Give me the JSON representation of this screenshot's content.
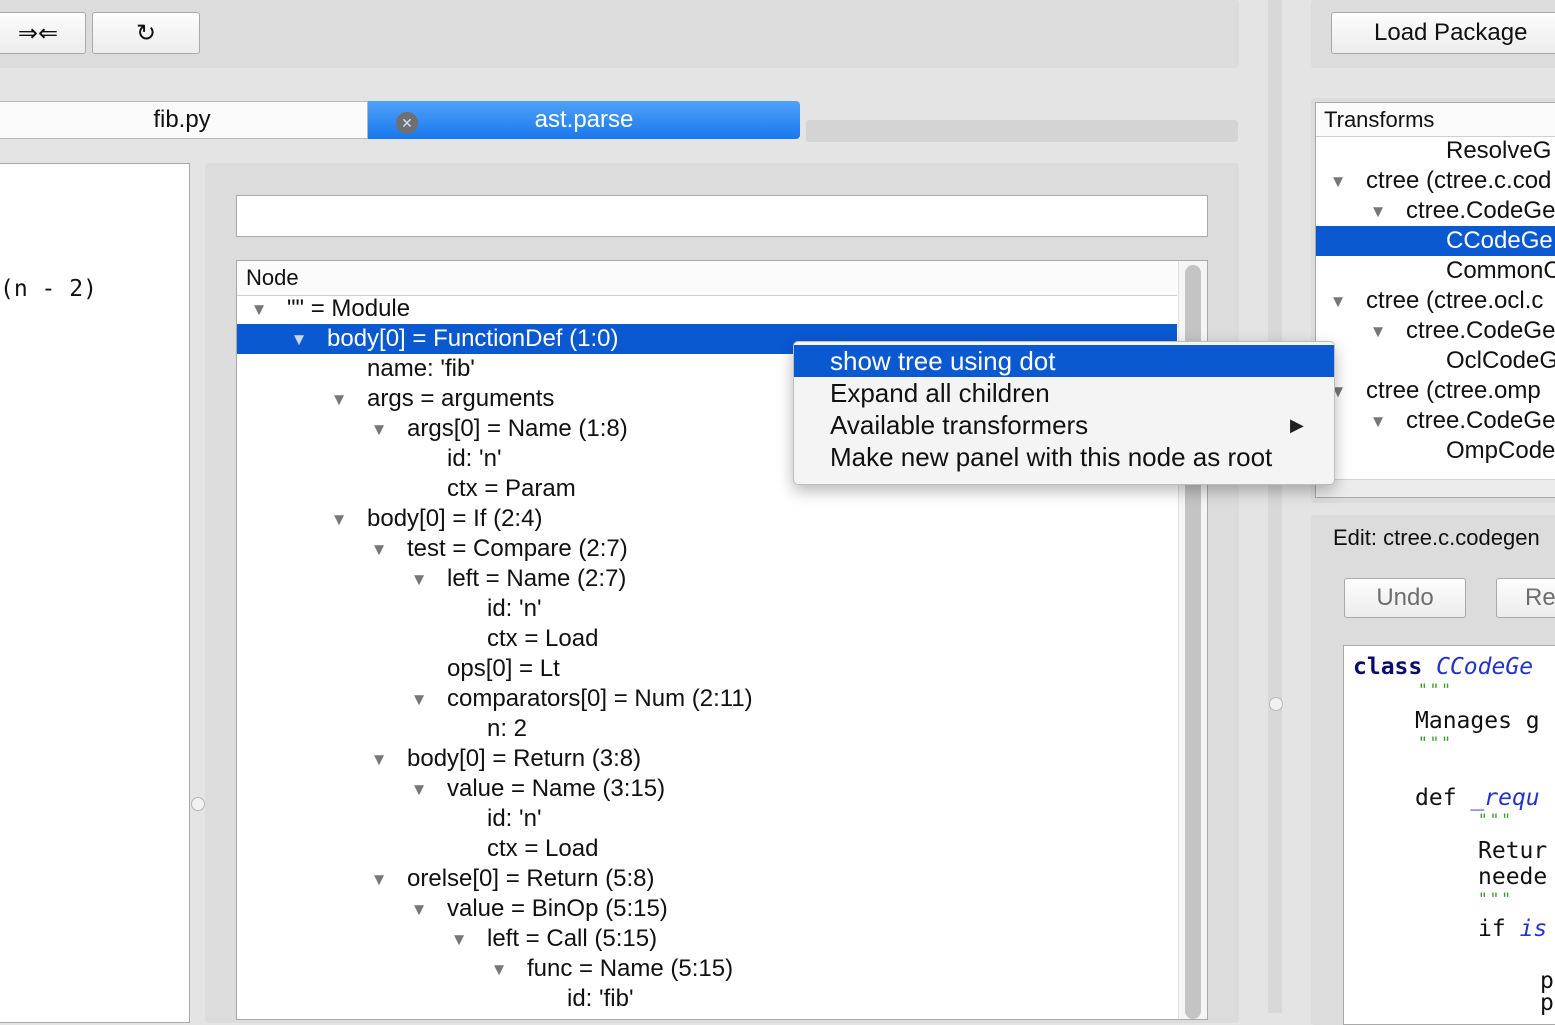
{
  "toolbar": {
    "nav_glyph": "⇒⇐",
    "refresh_glyph": "↻",
    "load_package_label": "Load Package"
  },
  "tabs": [
    {
      "label": "fib.py",
      "active": false
    },
    {
      "label": "ast.parse",
      "active": true,
      "closable": true
    }
  ],
  "close_glyph": "✕",
  "source_fragment": "(n - 2)",
  "ast_search": {
    "value": "",
    "placeholder": ""
  },
  "ast_tree": {
    "header": "Node",
    "rows": [
      {
        "label": "\"\" = Module",
        "expanded": true,
        "depth": 0
      },
      {
        "label": "body[0] = FunctionDef (1:0)",
        "expanded": true,
        "depth": 1,
        "selected": true
      },
      {
        "label": "name: 'fib'",
        "depth": 2
      },
      {
        "label": "args = arguments",
        "expanded": true,
        "depth": 2
      },
      {
        "label": "args[0] = Name (1:8)",
        "expanded": true,
        "depth": 3
      },
      {
        "label": "id: 'n'",
        "depth": 4
      },
      {
        "label": "ctx = Param",
        "depth": 4
      },
      {
        "label": "body[0] = If (2:4)",
        "expanded": true,
        "depth": 2
      },
      {
        "label": "test = Compare (2:7)",
        "expanded": true,
        "depth": 3
      },
      {
        "label": "left = Name (2:7)",
        "expanded": true,
        "depth": 4
      },
      {
        "label": "id: 'n'",
        "depth": 5
      },
      {
        "label": "ctx = Load",
        "depth": 5
      },
      {
        "label": "ops[0] = Lt",
        "depth": 4
      },
      {
        "label": "comparators[0] = Num (2:11)",
        "expanded": true,
        "depth": 4
      },
      {
        "label": "n: 2",
        "depth": 5
      },
      {
        "label": "body[0] = Return (3:8)",
        "expanded": true,
        "depth": 3
      },
      {
        "label": "value = Name (3:15)",
        "expanded": true,
        "depth": 4
      },
      {
        "label": "id: 'n'",
        "depth": 5
      },
      {
        "label": "ctx = Load",
        "depth": 5
      },
      {
        "label": "orelse[0] = Return (5:8)",
        "expanded": true,
        "depth": 3
      },
      {
        "label": "value = BinOp (5:15)",
        "expanded": true,
        "depth": 4
      },
      {
        "label": "left = Call (5:15)",
        "expanded": true,
        "depth": 5
      },
      {
        "label": "func = Name (5:15)",
        "expanded": true,
        "depth": 6
      },
      {
        "label": "id: 'fib'",
        "depth": 7
      }
    ]
  },
  "context_menu": {
    "items": [
      {
        "label": "show tree using dot",
        "highlighted": true
      },
      {
        "label": "Expand all children"
      },
      {
        "label": "Available transformers",
        "submenu": true
      },
      {
        "label": "Make new panel with this node as root"
      }
    ],
    "submenu_glyph": "▶"
  },
  "transforms": {
    "header": "Transforms",
    "rows": [
      {
        "label": "ResolveG",
        "depth": 3
      },
      {
        "label": "ctree (ctree.c.cod",
        "expanded": true,
        "depth": 1
      },
      {
        "label": "ctree.CodeGe",
        "expanded": true,
        "depth": 2
      },
      {
        "label": "CCodeGe",
        "depth": 3,
        "selected": true
      },
      {
        "label": "CommonC",
        "depth": 3
      },
      {
        "label": "ctree (ctree.ocl.c",
        "expanded": true,
        "depth": 1
      },
      {
        "label": "ctree.CodeGe",
        "expanded": true,
        "depth": 2
      },
      {
        "label": "OclCodeG",
        "depth": 3
      },
      {
        "label": "ctree (ctree.omp",
        "expanded": true,
        "depth": 1
      },
      {
        "label": "ctree.CodeGe",
        "expanded": true,
        "depth": 2
      },
      {
        "label": "OmpCode",
        "depth": 3
      }
    ]
  },
  "editor": {
    "title": "Edit: ctree.c.codegen",
    "undo_label": "Undo",
    "redo_label": "Re",
    "code": {
      "class_kw": "class",
      "class_name": "CCodeGe",
      "docstring_quote": "\"\"\"",
      "doc_text": "Manages g",
      "def_kw": "def",
      "def_name": "_requ",
      "ret_line1": "Retur",
      "ret_line2": "neede",
      "if_kw": "if",
      "if_name": "is",
      "p1": "p",
      "p2": "p"
    }
  }
}
